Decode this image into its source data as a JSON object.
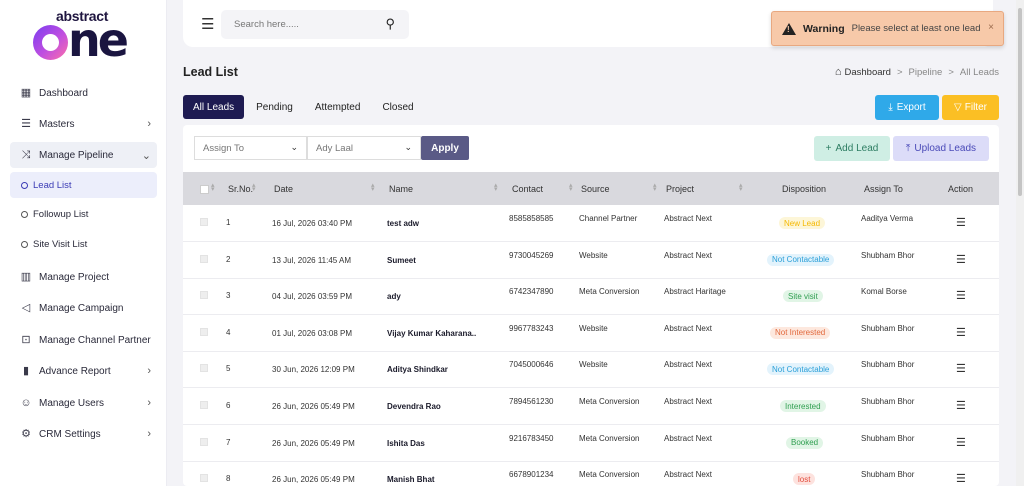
{
  "logo": {
    "small": "abstract",
    "big_first": "o",
    "big_rest": "ne"
  },
  "sidebar": {
    "items": [
      {
        "label": "Dashboard",
        "icon": "grid-icon"
      },
      {
        "label": "Masters",
        "icon": "list-icon"
      },
      {
        "label": "Manage Pipeline",
        "icon": "pipeline-icon"
      },
      {
        "label": "Manage Project",
        "icon": "building-icon"
      },
      {
        "label": "Manage Campaign",
        "icon": "megaphone-icon"
      },
      {
        "label": "Manage Channel Partner",
        "icon": "handshake-icon"
      },
      {
        "label": "Advance Report",
        "icon": "bar-chart-icon"
      },
      {
        "label": "Manage Users",
        "icon": "users-icon"
      },
      {
        "label": "CRM Settings",
        "icon": "gear-icon"
      }
    ],
    "pipeline_sub": [
      "Lead List",
      "Followup List",
      "Site Visit List"
    ]
  },
  "header": {
    "search_placeholder": "Search here....."
  },
  "toast": {
    "title": "Warning",
    "message": "Please select at least one lead",
    "close": "×"
  },
  "page": {
    "title": "Lead List",
    "breadcrumb": [
      "Dashboard",
      "Pipeline",
      "All Leads"
    ],
    "tabs": [
      "All Leads",
      "Pending",
      "Attempted",
      "Closed"
    ],
    "export_label": "Export",
    "filter_label": "Filter"
  },
  "filters": {
    "assign_to": "Assign To",
    "user": "Ady Laal",
    "apply": "Apply",
    "add_lead": "Add Lead",
    "upload_leads": "Upload Leads"
  },
  "table": {
    "columns": [
      "Sr.No.",
      "Date",
      "Name",
      "Contact",
      "Source",
      "Project",
      "Disposition",
      "Assign To",
      "Action"
    ],
    "rows": [
      {
        "sr": "1",
        "date": "16 Jul, 2026 03:40 PM",
        "name": "test adw",
        "contact": "8585858585",
        "source": "Channel Partner",
        "project": "Abstract Next",
        "disposition": "New Lead",
        "assign": "Aaditya Verma"
      },
      {
        "sr": "2",
        "date": "13 Jul, 2026 11:45 AM",
        "name": "Sumeet",
        "contact": "9730045269",
        "source": "Website",
        "project": "Abstract Next",
        "disposition": "Not Contactable",
        "assign": "Shubham Bhor"
      },
      {
        "sr": "3",
        "date": "04 Jul, 2026 03:59 PM",
        "name": "ady",
        "contact": "6742347890",
        "source": "Meta Conversion",
        "project": "Abstract Haritage",
        "disposition": "Site visit",
        "assign": "Komal Borse"
      },
      {
        "sr": "4",
        "date": "01 Jul, 2026 03:08 PM",
        "name": "Vijay Kumar Kaharana..",
        "contact": "9967783243",
        "source": "Website",
        "project": "Abstract Next",
        "disposition": "Not Interested",
        "assign": "Shubham Bhor"
      },
      {
        "sr": "5",
        "date": "30 Jun, 2026 12:09 PM",
        "name": "Aditya Shindkar",
        "contact": "7045000646",
        "source": "Website",
        "project": "Abstract Next",
        "disposition": "Not Contactable",
        "assign": "Shubham Bhor"
      },
      {
        "sr": "6",
        "date": "26 Jun, 2026 05:49 PM",
        "name": "Devendra Rao",
        "contact": "7894561230",
        "source": "Meta Conversion",
        "project": "Abstract Next",
        "disposition": "Interested",
        "assign": "Shubham Bhor"
      },
      {
        "sr": "7",
        "date": "26 Jun, 2026 05:49 PM",
        "name": "Ishita Das",
        "contact": "9216783450",
        "source": "Meta Conversion",
        "project": "Abstract Next",
        "disposition": "Booked",
        "assign": "Shubham Bhor"
      },
      {
        "sr": "8",
        "date": "26 Jun, 2026 05:49 PM",
        "name": "Manish Bhat",
        "contact": "6678901234",
        "source": "Meta Conversion",
        "project": "Abstract Next",
        "disposition": "lost",
        "assign": "Shubham Bhor"
      }
    ]
  },
  "colors": {
    "primary": "#1e1b52",
    "export": "#2fa9e9",
    "filter": "#fbbf24",
    "new_lead": "#f5b800",
    "not_contactable": "#2a9fd8",
    "site_visit": "#2e9e4f",
    "not_interested": "#e2683c",
    "interested": "#2e9e4f",
    "booked": "#2e9e4f",
    "lost": "#e24c3c"
  }
}
